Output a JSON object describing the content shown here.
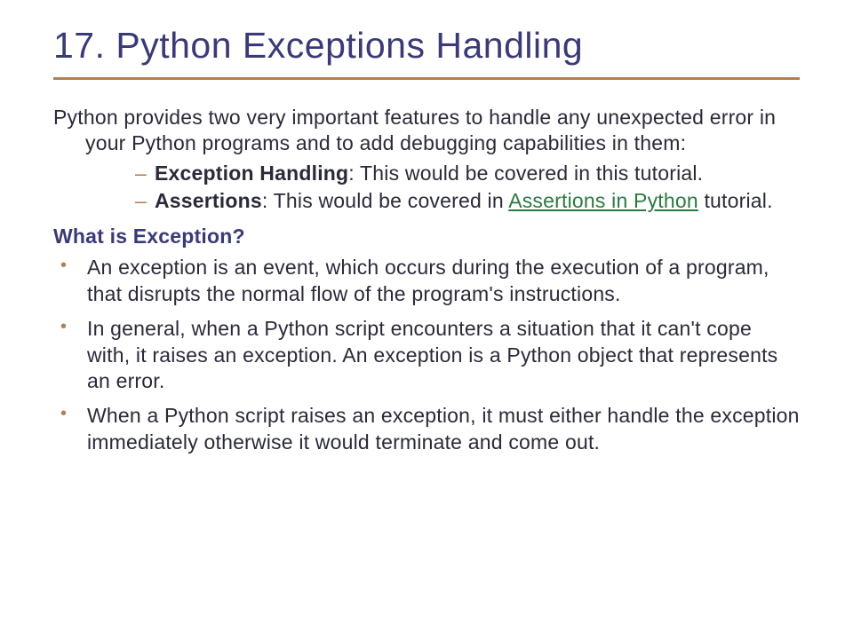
{
  "title": "17. Python Exceptions Handling",
  "intro": "Python provides two very important features to handle any unexpected error in your Python programs and to add debugging capabilities in them:",
  "features": [
    {
      "name": "Exception Handling",
      "desc": ": This would be covered in this tutorial."
    },
    {
      "name": "Assertions",
      "desc_pre": ": This would be covered in ",
      "link": "Assertions in Python",
      "desc_post": " tutorial."
    }
  ],
  "subheading": "What is Exception?",
  "bullets": [
    "An exception is an event, which occurs during the execution of a program, that disrupts the normal flow of the program's instructions.",
    "In general, when a Python script encounters a situation that it can't cope with, it raises an exception. An exception is a Python object that represents an error.",
    "When a Python script raises an exception, it must either handle the exception immediately otherwise it would terminate and come out."
  ]
}
